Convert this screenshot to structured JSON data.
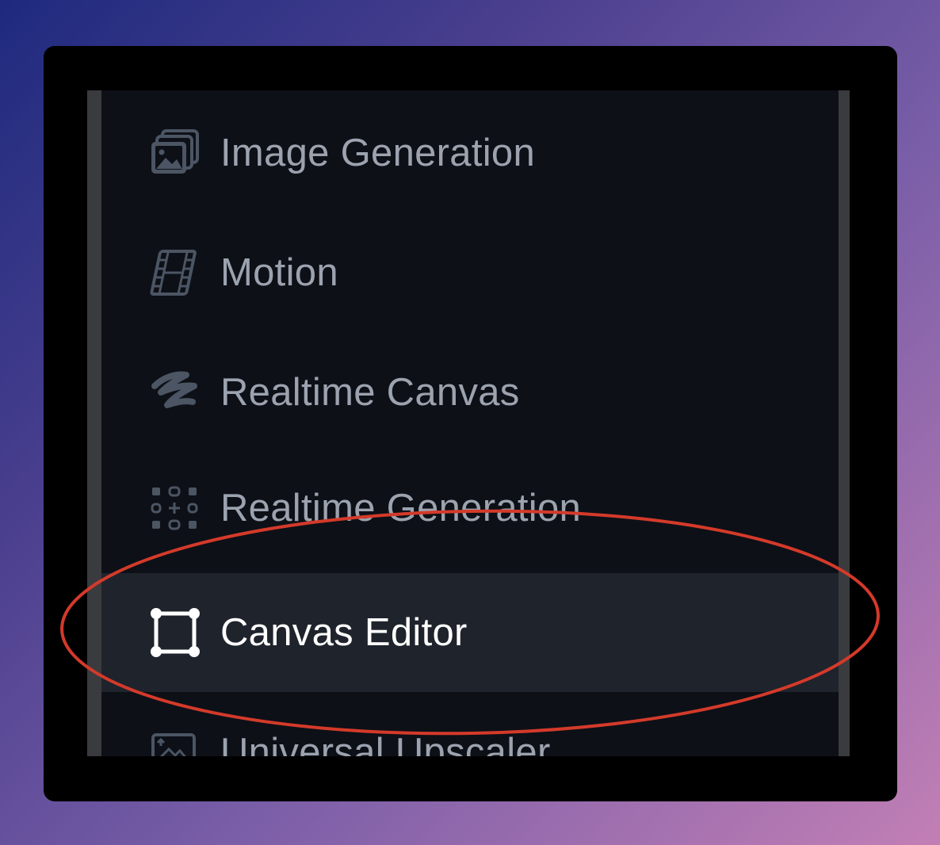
{
  "menu": {
    "items": [
      {
        "label": "Image Generation",
        "icon": "image-stack-icon",
        "active": false
      },
      {
        "label": "Motion",
        "icon": "film-icon",
        "active": false
      },
      {
        "label": "Realtime Canvas",
        "icon": "scribble-icon",
        "active": false
      },
      {
        "label": "Realtime Generation",
        "icon": "dot-grid-icon",
        "active": false
      },
      {
        "label": "Canvas Editor",
        "icon": "bounding-box-icon",
        "active": true
      },
      {
        "label": "Universal Upscaler",
        "icon": "upscale-image-icon",
        "active": false
      }
    ]
  },
  "colors": {
    "highlight_ring": "#d43a2a",
    "active_background": "#1f232c",
    "inactive_text": "#9ca3af",
    "active_text": "#ffffff"
  }
}
